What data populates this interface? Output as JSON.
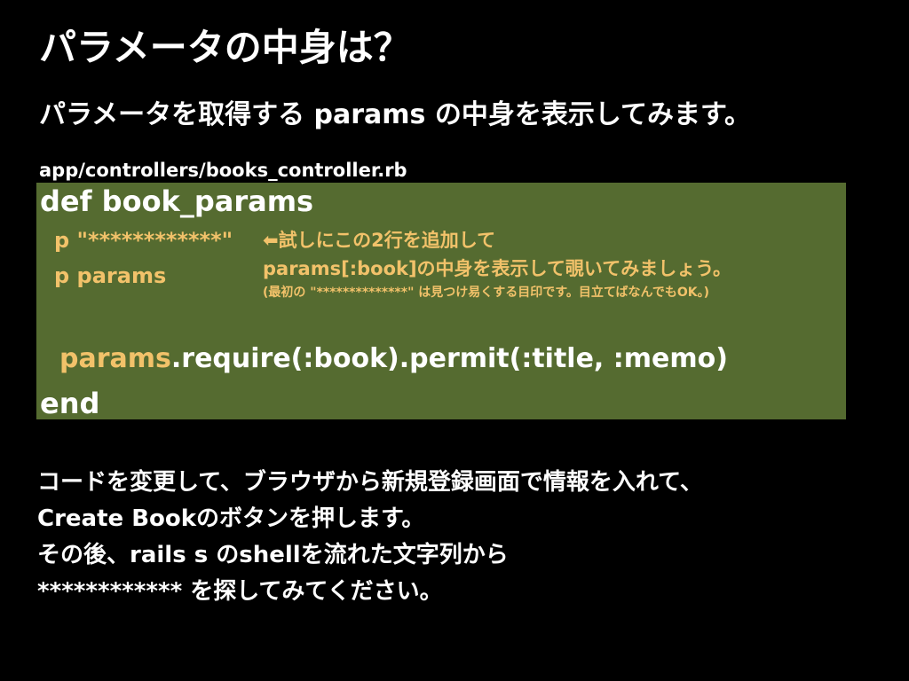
{
  "title": "パラメータの中身は？",
  "subtitle": "パラメータを取得する params の中身を表示してみます。",
  "file_path": "app/controllers/books_controller.rb",
  "code": {
    "def_line": "def book_params",
    "p_line_1": "p \"************\"",
    "p_line_2": "p params",
    "comment_1": "⬅試しにこの2行を追加して",
    "comment_2": "params[:book]の中身を表示して覗いてみましょう。",
    "comment_3": "(最初の \"**************\" は見つけ易くする目印です。目立てばなんでもOK。)",
    "require_prefix": "params",
    "require_rest": ".require(:book).permit(:title, :memo)",
    "end_line": "end"
  },
  "body": {
    "line_1": "コードを変更して、ブラウザから新規登録画面で情報を入れて、",
    "line_2": "Create Bookのボタンを押します。",
    "line_3": "その後、rails s のshellを流れた文字列から",
    "line_4": "************ を探してみてください。"
  },
  "colors": {
    "background": "#000000",
    "code_box": "#556b30",
    "highlight": "#f2c26a",
    "text": "#ffffff"
  }
}
